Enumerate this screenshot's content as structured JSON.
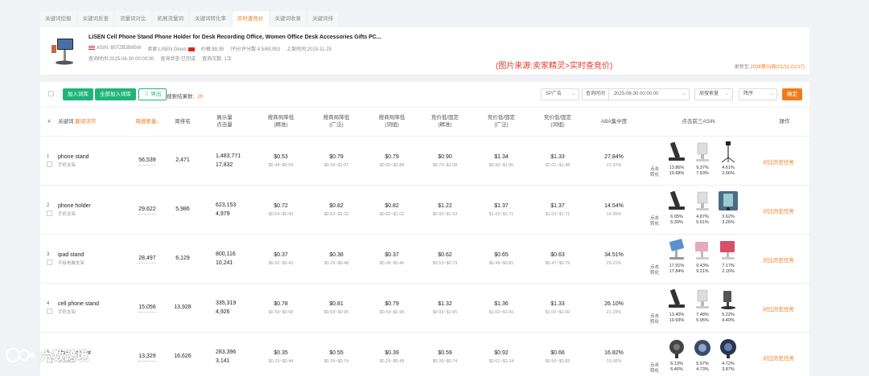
{
  "tabs": [
    {
      "label": "关键词挖掘",
      "active": false
    },
    {
      "label": "关键词反查",
      "active": false
    },
    {
      "label": "流量词对比",
      "active": false
    },
    {
      "label": "拓展流量词",
      "active": false
    },
    {
      "label": "关键词转化率",
      "active": false
    },
    {
      "label": "实时查竞价",
      "active": true
    },
    {
      "label": "关键词收录",
      "active": false
    },
    {
      "label": "关键词排",
      "active": false
    }
  ],
  "product": {
    "title": "LISEN Cell Phone Stand Phone Holder for Desk Recording Office, Women Office Desk Accessories Gifts PC...",
    "asin": "ASIN: B07ZB3B95W",
    "seller": "卖家:LISEN Direct",
    "price": "价格:$9.95",
    "rating": "评分/评分数:4.5/69,953",
    "launch": "上架时间:2019-11-25",
    "query_time": "查询时间:2025-06-30 00:00:00",
    "query_status": "查询状态:已完成",
    "query_count": "查询次数: 1次",
    "update_label": "更新至:",
    "update_value": "2026第03周(01/11-01/17)"
  },
  "source_note": "(图片来源:卖家精灵>实时查竞价)",
  "toolbar": {
    "add_words": "加入词库",
    "add_all": "全部加入词库",
    "export": "导出",
    "result_label": "搜索结果数:",
    "result_count": "20",
    "ad_type": "SP广告",
    "query_time_label": "查询时间",
    "query_time_value": "2025-06-30 00:00:00",
    "sort_field": "周搜索量",
    "sort_order": "降序",
    "confirm": "确定"
  },
  "headers": {
    "keyword": "关键词",
    "keyword_hl": "翻译词节",
    "weekly_search": "周搜索量",
    "weekly_rank": "周排名",
    "impressions": "展示量",
    "clicks": "点击量",
    "sug_exact": [
      "搜商局降低",
      "(精准)"
    ],
    "sug_broad": [
      "搜商局降低",
      "(广泛)"
    ],
    "sug_phrase": [
      "搜商局降低",
      "(词组)"
    ],
    "bid_exact": [
      "竞价低/固定",
      "(精准)"
    ],
    "bid_broad": [
      "竞价低/固定",
      "(广泛)"
    ],
    "bid_phrase": [
      "竞价低/固定",
      "(词组)"
    ],
    "aba": "ABA集中度",
    "top3": "点击前三ASIN",
    "action": "操作"
  },
  "asin_labels": [
    "点击",
    "转化"
  ],
  "action_label": "对比历史任务",
  "rows": [
    {
      "idx": "1",
      "kw": "phone stand",
      "cn": "手机支架",
      "search": "56,539",
      "rank": "2,471",
      "imp": "1,483,771",
      "clk": "17,832",
      "s1": "$0.53",
      "s1r": "$0.44~$0.64",
      "s2": "$0.79",
      "s2r": "$0.59~$1.07",
      "s3": "$0.79",
      "s3r": "$0.60~$0.88",
      "b1": "$0.90",
      "b1r": "$0.74~$1.08",
      "b2": "$1.34",
      "b2r": "$0.99~$1.80",
      "b3": "$1.33",
      "b3r": "$1.01~$1.48",
      "aba": "27.84%",
      "aba2": "21.37%",
      "asins": [
        {
          "c": "13.86%",
          "v": "10.68%"
        },
        {
          "c": "9.37%",
          "v": "7.93%"
        },
        {
          "c": "4.61%",
          "v": "2.66%"
        }
      ]
    },
    {
      "idx": "2",
      "kw": "phone holder",
      "cn": "手机支架",
      "search": "29,622",
      "rank": "5,986",
      "imp": "623,153",
      "clk": "4,979",
      "s1": "$0.72",
      "s1r": "$0.54~$0.90",
      "s2": "$0.82",
      "s2r": "$0.62~$1.02",
      "s3": "$0.82",
      "s3r": "$0.62~$1.02",
      "b1": "$1.22",
      "b1r": "$0.93~$1.53",
      "b2": "$1.37",
      "b2r": "$1.03~$1.71",
      "b3": "$1.37",
      "b3r": "$1.03~$1.71",
      "aba": "14.54%",
      "aba2": "14.36%",
      "asins": [
        {
          "c": "6.05%",
          "v": "5.39%"
        },
        {
          "c": "4.87%",
          "v": "5.61%"
        },
        {
          "c": "3.62%",
          "v": "3.26%"
        }
      ]
    },
    {
      "idx": "3",
      "kw": "ipad stand",
      "cn": "平板电脑支架",
      "search": "28,497",
      "rank": "6,129",
      "imp": "800,116",
      "clk": "10,241",
      "s1": "$0.37",
      "s1r": "$0.32~$0.43",
      "s2": "$0.38",
      "s2r": "$0.29~$0.48",
      "s3": "$0.37",
      "s3r": "$0.28~$0.46",
      "b1": "$0.62",
      "b1r": "$0.53~$0.73",
      "b2": "$0.65",
      "b2r": "$0.49~$0.81",
      "b3": "$0.63",
      "b3r": "$0.47~$0.79",
      "aba": "34.51%",
      "aba2": "29.21%",
      "asins": [
        {
          "c": "17.91%",
          "v": "17.84%"
        },
        {
          "c": "9.43%",
          "v": "9.21%"
        },
        {
          "c": "7.17%",
          "v": "2.16%"
        }
      ]
    },
    {
      "idx": "4",
      "kw": "cell phone stand",
      "cn": "手机支架",
      "search": "15,056",
      "rank": "13,928",
      "imp": "335,319",
      "clk": "4,926",
      "s1": "$0.78",
      "s1r": "$0.59~$0.98",
      "s2": "$0.81",
      "s2r": "$0.59~$0.95",
      "s3": "$0.79",
      "s3r": "$0.59~$0.99",
      "b1": "$1.32",
      "b1r": "$0.99~$1.65",
      "b2": "$1.36",
      "b2r": "$1.00~$1.60",
      "b3": "$1.33",
      "b3r": "$1.00~$1.60",
      "aba": "26.10%",
      "aba2": "21.29%",
      "asins": [
        {
          "c": "13.40%",
          "v": "10.93%"
        },
        {
          "c": "7.48%",
          "v": "5.95%"
        },
        {
          "c": "5.22%",
          "v": "4.40%"
        }
      ]
    },
    {
      "idx": "5",
      "kw": "phone mount",
      "cn": "手机支架",
      "search": "13,329",
      "rank": "16,626",
      "imp": "283,396",
      "clk": "3,141",
      "s1": "$0.35",
      "s1r": "$0.33~$0.44",
      "s2": "$0.55",
      "s2r": "$0.39~$0.74",
      "s3": "$0.39",
      "s3r": "$0.29~$0.49",
      "b1": "$0.59",
      "b1r": "$0.39~$0.74",
      "b2": "$0.92",
      "b2r": "$0.61~$1.24",
      "b3": "$0.66",
      "b3r": "$0.50~$0.83",
      "aba": "16.82%",
      "aba2": "15.06%",
      "asins": [
        {
          "c": "6.13%",
          "v": "6.46%"
        },
        {
          "c": "5.97%",
          "v": "4.73%"
        },
        {
          "c": "4.72%",
          "v": "3.87%"
        }
      ]
    }
  ],
  "watermark": "六数跨境"
}
